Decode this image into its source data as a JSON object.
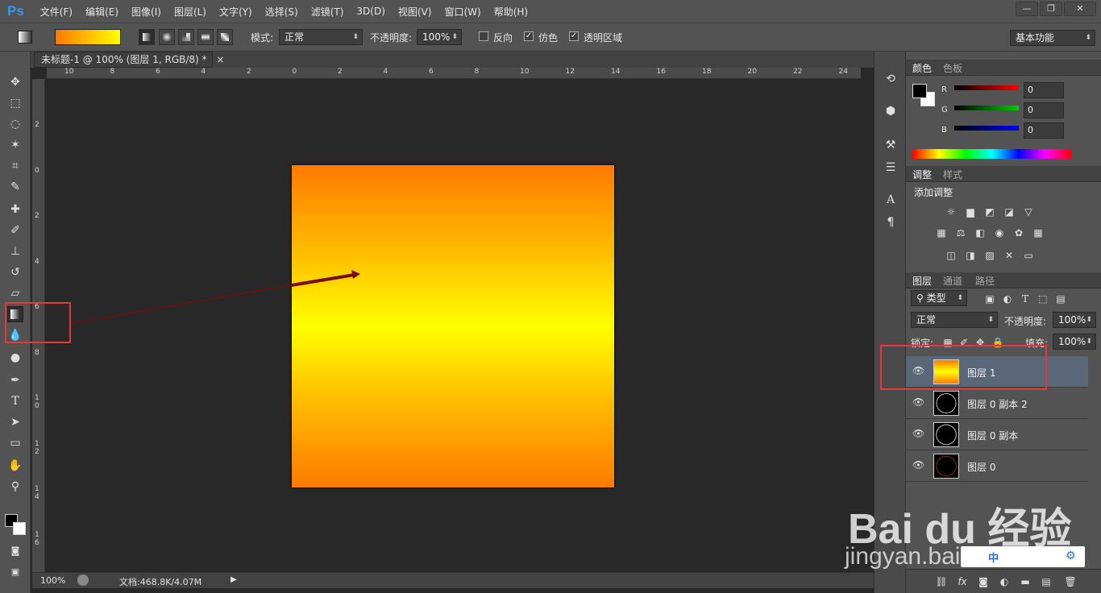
{
  "app": {
    "logo": "Ps"
  },
  "menu": [
    "文件(F)",
    "编辑(E)",
    "图像(I)",
    "图层(L)",
    "文字(Y)",
    "选择(S)",
    "滤镜(T)",
    "3D(D)",
    "视图(V)",
    "窗口(W)",
    "帮助(H)"
  ],
  "window_controls": {
    "minimize": "—",
    "restore": "❐",
    "close": "✕"
  },
  "options": {
    "mode_label": "模式:",
    "mode_value": "正常",
    "opacity_label": "不透明度:",
    "opacity_value": "100%",
    "reverse_label": "反向",
    "dither_label": "仿色",
    "transparency_label": "透明区域",
    "reverse_checked": false,
    "dither_checked": true,
    "transparency_checked": true,
    "workspace": "基本功能",
    "gradient_colors": [
      "#ff7a00",
      "#ffff00"
    ]
  },
  "document": {
    "tab_title": "未标题-1 @ 100% (图层 1, RGB/8) *",
    "close": "×"
  },
  "rulers": {
    "h": [
      "10",
      "8",
      "6",
      "4",
      "2",
      "0",
      "2",
      "4",
      "6",
      "8",
      "10",
      "12",
      "14",
      "16",
      "18",
      "20",
      "22",
      "24"
    ],
    "v": [
      "2",
      "0",
      "2",
      "4",
      "6",
      "8",
      "1 0",
      "1 2",
      "1 4",
      "1 6"
    ]
  },
  "status": {
    "zoom": "100%",
    "doc_info": "文档:468.8K/4.07M"
  },
  "color_panel": {
    "tabs": [
      "颜色",
      "色板"
    ],
    "channels": [
      {
        "label": "R",
        "value": "0"
      },
      {
        "label": "G",
        "value": "0"
      },
      {
        "label": "B",
        "value": "0"
      }
    ]
  },
  "adjust_panel": {
    "tabs": [
      "调整",
      "样式"
    ],
    "title": "添加调整"
  },
  "layers_panel": {
    "tabs": [
      "图层",
      "通道",
      "路径"
    ],
    "filter": "类型",
    "blend_mode": "正常",
    "opacity_label": "不透明度:",
    "opacity_value": "100%",
    "lock_label": "锁定:",
    "fill_label": "填充:",
    "fill_value": "100%",
    "layers": [
      "图层 1",
      "图层 0 副本 2",
      "图层 0 副本",
      "图层 0"
    ]
  },
  "watermark": {
    "brand": "Bai du 经验",
    "url": "jingyan.baidu.com",
    "toolbar": [
      "中",
      "⚙"
    ]
  }
}
